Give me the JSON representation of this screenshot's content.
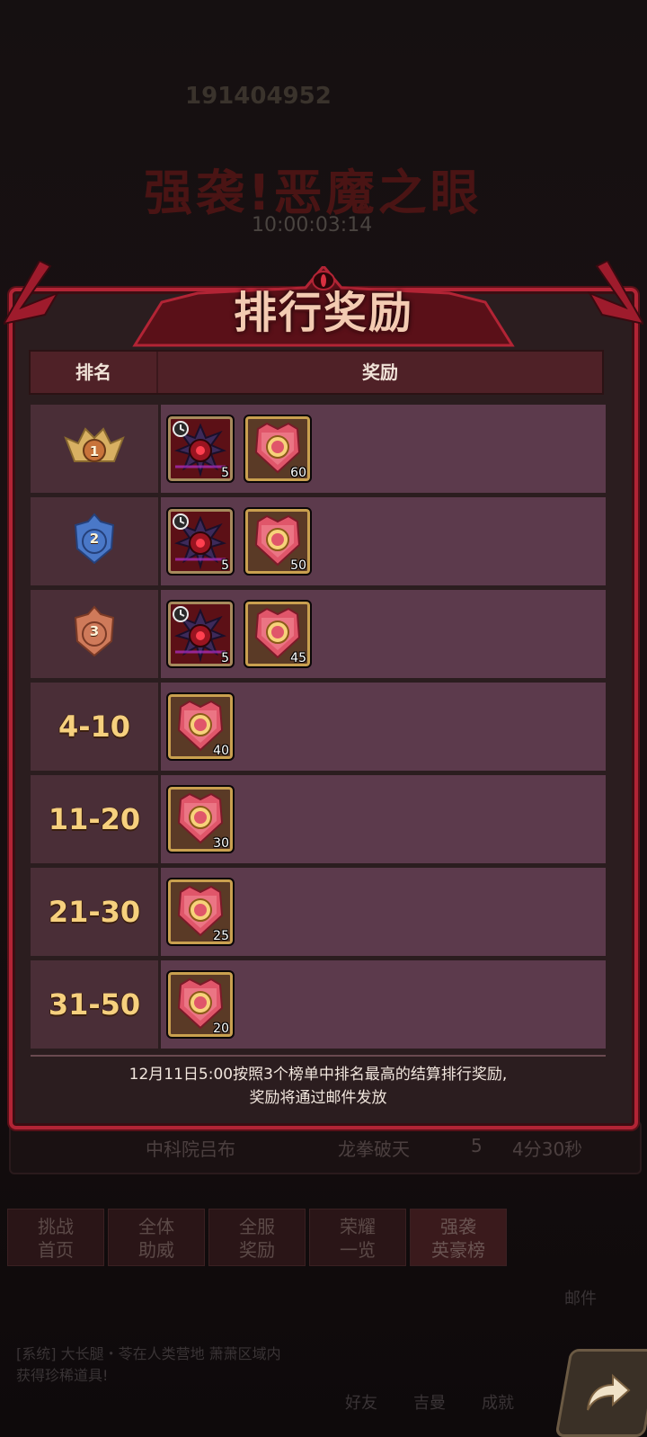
{
  "background": {
    "player_id": "191404952",
    "event_title": "强袭!恶魔之眼",
    "timer": "10:00:03:14",
    "row": {
      "name": "中科院吕布",
      "guild": "龙拳破天",
      "stars": "5",
      "time": "4分30秒"
    },
    "tabs": [
      {
        "line1": "挑战",
        "line2": "首页"
      },
      {
        "line1": "全体",
        "line2": "助威"
      },
      {
        "line1": "全服",
        "line2": "奖励"
      },
      {
        "line1": "荣耀",
        "line2": "一览"
      },
      {
        "line1": "强袭",
        "line2": "英豪榜"
      }
    ],
    "mail_label": "邮件",
    "chat_text": "[系统] 大长腿・苓在人类营地 萧萧区域内获得珍稀道具!",
    "bottom_nav": [
      "好友",
      "吉曼",
      "成就"
    ]
  },
  "dialog": {
    "title": "排行奖励",
    "header_rank": "排名",
    "header_reward": "奖励",
    "rows": [
      {
        "rank": "1",
        "badge": "gold",
        "items": [
          {
            "type": "eye",
            "count": "5",
            "timed": true
          },
          {
            "type": "shield",
            "count": "60"
          }
        ]
      },
      {
        "rank": "2",
        "badge": "blue",
        "items": [
          {
            "type": "eye",
            "count": "5",
            "timed": true
          },
          {
            "type": "shield",
            "count": "50"
          }
        ]
      },
      {
        "rank": "3",
        "badge": "bronze",
        "items": [
          {
            "type": "eye",
            "count": "5",
            "timed": true
          },
          {
            "type": "shield",
            "count": "45"
          }
        ]
      },
      {
        "rank": "4-10",
        "items": [
          {
            "type": "shield",
            "count": "40"
          }
        ]
      },
      {
        "rank": "11-20",
        "items": [
          {
            "type": "shield",
            "count": "30"
          }
        ]
      },
      {
        "rank": "21-30",
        "items": [
          {
            "type": "shield",
            "count": "25"
          }
        ]
      },
      {
        "rank": "31-50",
        "items": [
          {
            "type": "shield",
            "count": "20"
          }
        ]
      }
    ],
    "note_line1": "12月11日5:00按照3个榜单中排名最高的结算排行奖励,",
    "note_line2": "奖励将通过邮件发放"
  },
  "colors": {
    "frame": "#b22435",
    "rank_text": "#f6d07e",
    "row_bg": "#5c3a4c"
  }
}
